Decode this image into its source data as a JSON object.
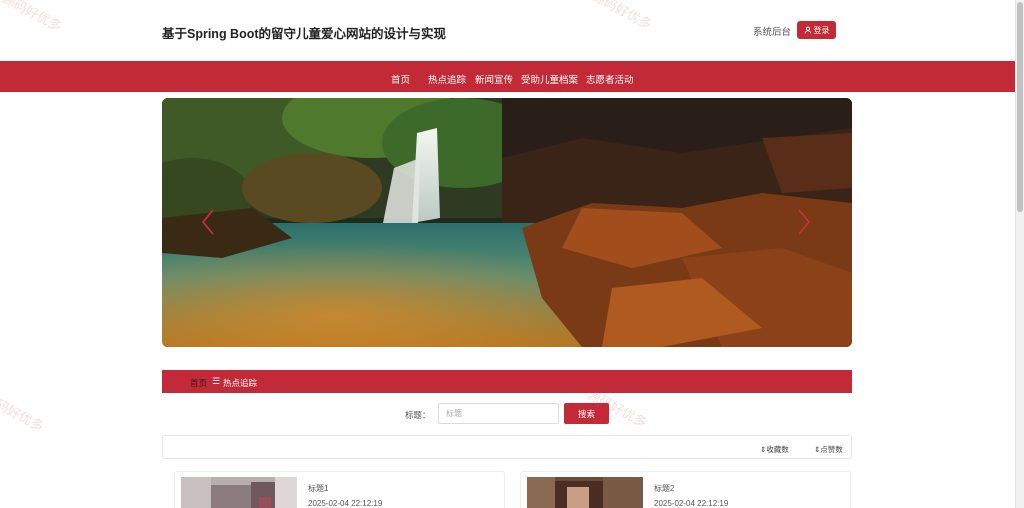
{
  "header": {
    "site_title": "基于Spring Boot的留守儿童爱心网站的设计与实现",
    "admin_link": "系统后台",
    "login_label": "登录"
  },
  "nav": {
    "items": [
      {
        "label": "首页"
      },
      {
        "label": "热点追踪"
      },
      {
        "label": "新闻宣传"
      },
      {
        "label": "受助儿童档案"
      },
      {
        "label": "志愿者活动"
      }
    ]
  },
  "carousel": {
    "prev_icon": "chevron-left-icon",
    "next_icon": "chevron-right-icon"
  },
  "breadcrumb": {
    "home": "首页",
    "separator": "☰",
    "current": "热点追踪"
  },
  "search": {
    "label": "标题：",
    "placeholder": "标题",
    "value": "",
    "button": "搜索"
  },
  "sort": {
    "favorites": "收藏数",
    "likes": "点赞数"
  },
  "cards": [
    {
      "title": "标题1",
      "date": "2025-02-04 22:12:19"
    },
    {
      "title": "标题2",
      "date": "2025-02-04 22:12:19"
    }
  ],
  "watermark": "源码好优多",
  "colors": {
    "accent": "#c22a38"
  }
}
